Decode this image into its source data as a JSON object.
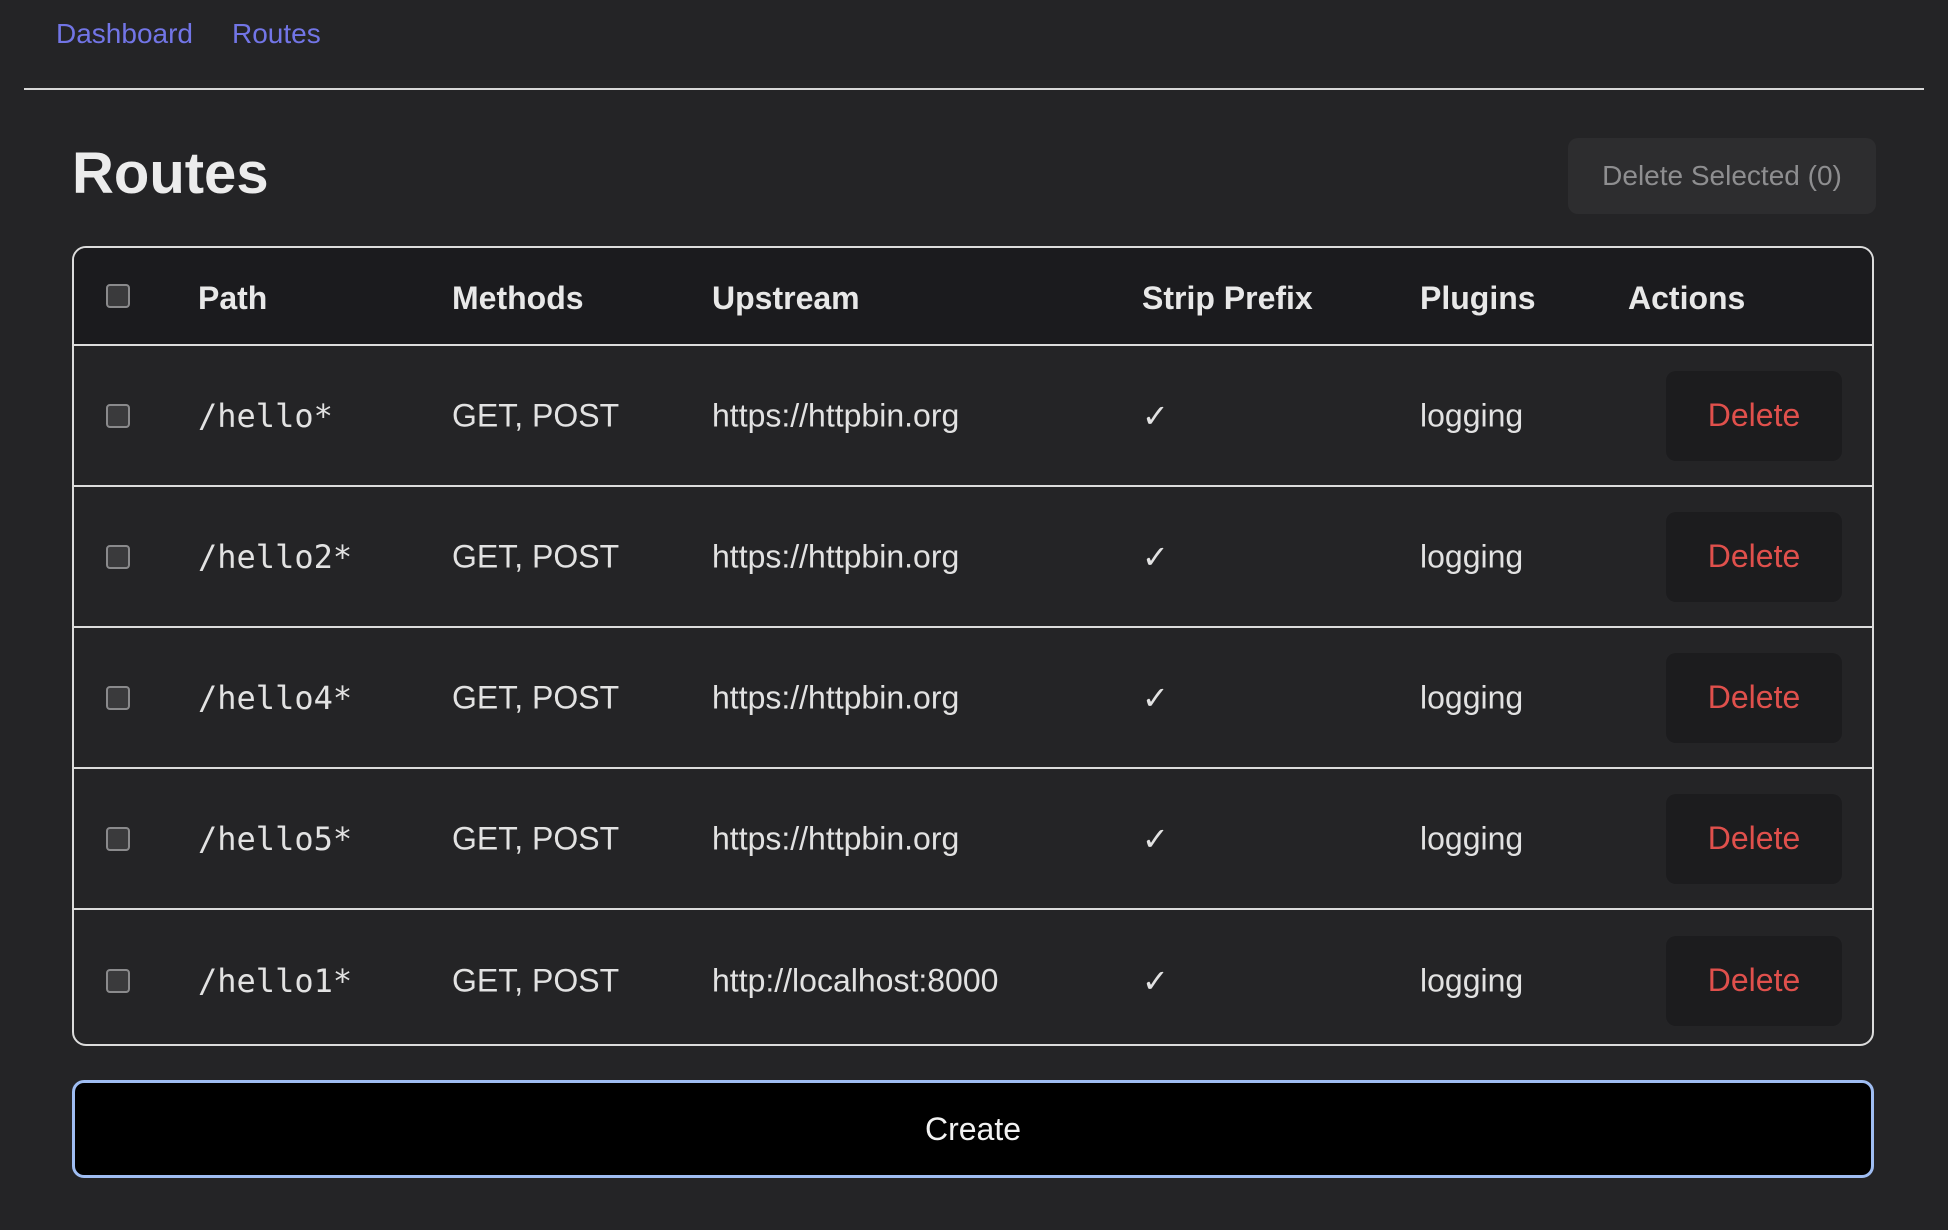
{
  "nav": {
    "items": [
      {
        "label": "Dashboard"
      },
      {
        "label": "Routes"
      }
    ],
    "link_color": "#7275e6"
  },
  "page": {
    "title": "Routes",
    "delete_selected_label": "Delete Selected (0)"
  },
  "table": {
    "headers": {
      "path": "Path",
      "methods": "Methods",
      "upstream": "Upstream",
      "strip_prefix": "Strip Prefix",
      "plugins": "Plugins",
      "actions": "Actions"
    },
    "rows": [
      {
        "path": "/hello*",
        "methods": "GET, POST",
        "upstream": "https://httpbin.org",
        "strip_prefix": "✓",
        "plugins": "logging",
        "action_label": "Delete",
        "checked": false
      },
      {
        "path": "/hello2*",
        "methods": "GET, POST",
        "upstream": "https://httpbin.org",
        "strip_prefix": "✓",
        "plugins": "logging",
        "action_label": "Delete",
        "checked": false
      },
      {
        "path": "/hello4*",
        "methods": "GET, POST",
        "upstream": "https://httpbin.org",
        "strip_prefix": "✓",
        "plugins": "logging",
        "action_label": "Delete",
        "checked": false
      },
      {
        "path": "/hello5*",
        "methods": "GET, POST",
        "upstream": "https://httpbin.org",
        "strip_prefix": "✓",
        "plugins": "logging",
        "action_label": "Delete",
        "checked": false
      },
      {
        "path": "/hello1*",
        "methods": "GET, POST",
        "upstream": "http://localhost:8000",
        "strip_prefix": "✓",
        "plugins": "logging",
        "action_label": "Delete",
        "checked": false
      }
    ],
    "delete_color": "#e0504c"
  },
  "create_label": "Create",
  "colors": {
    "background": "#242426",
    "header_background": "#1b1b1e",
    "create_border": "#9fbdf2"
  }
}
